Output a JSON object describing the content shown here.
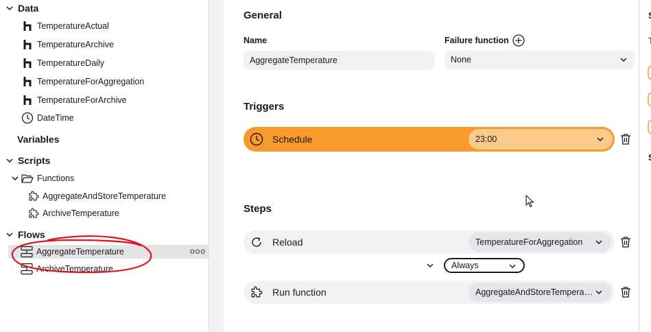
{
  "sidebar": {
    "sections": {
      "data": "Data",
      "variables": "Variables",
      "scripts": "Scripts",
      "flows": "Flows"
    },
    "data_items": [
      "TemperatureActual",
      "TemperatureArchive",
      "TemperatureDaily",
      "TemperatureForAggregation",
      "TemperatureForArchive",
      "DateTime"
    ],
    "functions_folder": "Functions",
    "function_items": [
      "AggregateAndStoreTemperature",
      "ArchiveTemperature"
    ],
    "flow_items": [
      "AggregateTemperature",
      "ArchiveTemperature"
    ],
    "more_label": "ooo"
  },
  "general": {
    "heading": "General",
    "name_label": "Name",
    "name_value": "AggregateTemperature",
    "failure_label": "Failure function",
    "failure_value": "None"
  },
  "triggers": {
    "heading": "Triggers",
    "schedule_label": "Schedule",
    "schedule_time": "23:00"
  },
  "steps": {
    "heading": "Steps",
    "items": [
      {
        "label": "Reload",
        "value": "TemperatureForAggregation"
      },
      {
        "label": "Run function",
        "value": "AggregateAndStoreTemperature"
      }
    ],
    "condition": "Always"
  },
  "right_panel": {
    "letters": [
      "S",
      "T",
      "S"
    ]
  },
  "colors": {
    "accent": "#f7992b",
    "accent_light": "#fbc98a",
    "annotation": "#e0141e"
  }
}
